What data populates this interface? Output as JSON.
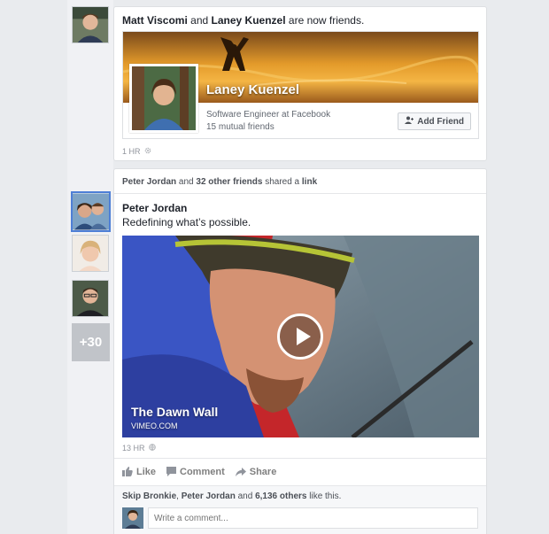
{
  "story1": {
    "actor1": "Matt Viscomi",
    "conj": "and",
    "actor2": "Laney Kuenzel",
    "suffix": "are now friends.",
    "friend": {
      "name": "Laney Kuenzel",
      "title": "Software Engineer at Facebook",
      "mutual": "15 mutual friends",
      "add_friend_label": "Add Friend"
    },
    "time": "1 HR"
  },
  "story2": {
    "header": {
      "actor": "Peter Jordan",
      "conj": "and",
      "others": "32 other friends",
      "verb": "shared a",
      "object": "link"
    },
    "more_count": "+30",
    "poster": "Peter Jordan",
    "text": "Redefining what’s possible.",
    "video": {
      "title": "The Dawn Wall",
      "source": "VIMEO.COM"
    },
    "time": "13 HR",
    "actions": {
      "like": "Like",
      "comment": "Comment",
      "share": "Share"
    },
    "likes": {
      "name1": "Skip Bronkie",
      "sep": ",",
      "name2": "Peter Jordan",
      "conj": "and",
      "others": "6,136 others",
      "suffix": "like this."
    },
    "comment_placeholder": "Write a comment..."
  },
  "colors": {
    "background": "#e9ebee",
    "card_border": "#dddfe2",
    "active_avatar_border": "#4e7fd6",
    "muted_text": "#90949c"
  },
  "icons": {
    "settings": "gear-icon",
    "globe": "globe-icon",
    "add_friend": "add-person-icon",
    "like": "thumbs-up-icon",
    "comment": "comment-bubble-icon",
    "share": "share-arrow-icon",
    "play": "play-icon"
  }
}
